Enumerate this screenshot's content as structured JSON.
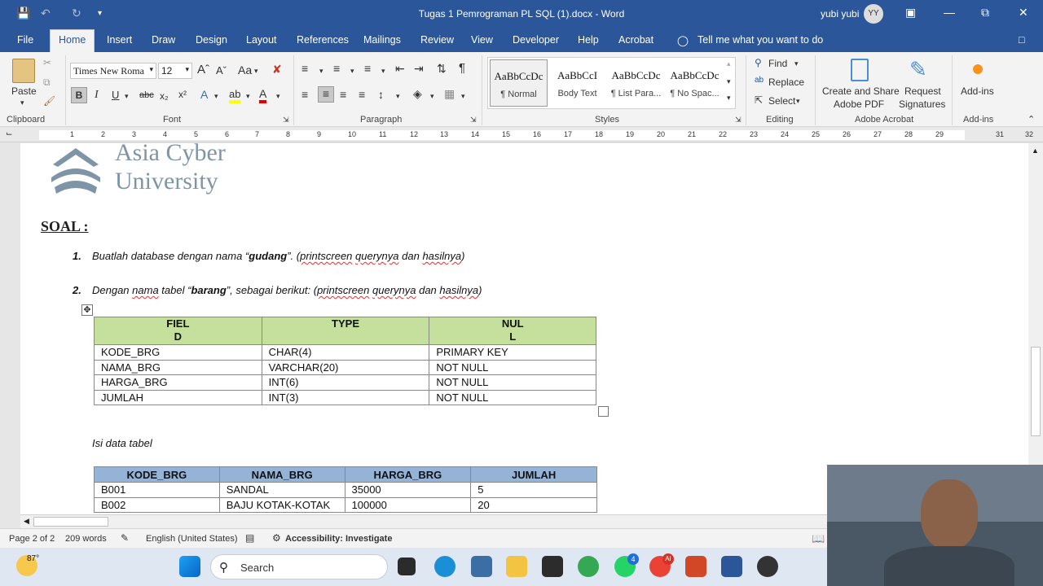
{
  "window": {
    "title": "Tugas 1 Pemrograman PL SQL (1).docx  -  Word",
    "user_name": "yubi yubi",
    "user_initials": "YY"
  },
  "menu": {
    "tabs": [
      "File",
      "Home",
      "Insert",
      "Draw",
      "Design",
      "Layout",
      "References",
      "Mailings",
      "Review",
      "View",
      "Developer",
      "Help",
      "Acrobat"
    ],
    "tell_me": "Tell me what you want to do"
  },
  "ribbon": {
    "clipboard": {
      "paste": "Paste",
      "label": "Clipboard"
    },
    "font": {
      "name": "Times New Roma",
      "size": "12",
      "label": "Font",
      "bold": "B",
      "italic": "I",
      "underline": "U",
      "case": "Aa"
    },
    "paragraph": {
      "label": "Paragraph"
    },
    "styles": {
      "label": "Styles",
      "items": [
        {
          "sample": "AaBbCcDc",
          "name": "¶ Normal"
        },
        {
          "sample": "AaBbCcI",
          "name": "Body Text"
        },
        {
          "sample": "AaBbCcDc",
          "name": "¶ List Para..."
        },
        {
          "sample": "AaBbCcDc",
          "name": "¶ No Spac..."
        }
      ]
    },
    "editing": {
      "find": "Find",
      "replace": "Replace",
      "select": "Select",
      "label": "Editing"
    },
    "acrobat": {
      "create_share_1": "Create and Share",
      "create_share_2": "Adobe PDF",
      "request_1": "Request",
      "request_2": "Signatures",
      "label": "Adobe Acrobat"
    },
    "addins": {
      "button": "Add-ins",
      "label": "Add-ins"
    }
  },
  "ruler": {
    "numbers": [
      "1",
      "2",
      "3",
      "4",
      "5",
      "6",
      "7",
      "8",
      "9",
      "10",
      "11",
      "12",
      "13",
      "14",
      "15",
      "16",
      "17",
      "18",
      "19",
      "20",
      "21",
      "22",
      "23",
      "24",
      "25",
      "26",
      "27",
      "28",
      "29",
      "31",
      "32"
    ]
  },
  "document": {
    "logo_line1": "Asia Cyber",
    "logo_line2": "University",
    "soal": "SOAL :",
    "q1": {
      "num": "1.",
      "a": "Buatlah database dengan nama “",
      "b": "gudang",
      "c": "”. (",
      "d": "printscreen",
      "e": " ",
      "f": "querynya",
      "g": " dan ",
      "h": "hasilnya",
      "i": ")"
    },
    "q2": {
      "num": "2.",
      "a": "Dengan ",
      "b": "nama",
      "c": " tabel “",
      "d": "barang",
      "e": "”, sebagai berikut: (",
      "f": "printscreen",
      "g": " ",
      "h": "querynya",
      "i": " dan ",
      "j": "hasilnya",
      "k": ")"
    },
    "table1": {
      "headers": [
        [
          "FIEL",
          "D"
        ],
        [
          "TYPE",
          ""
        ],
        [
          "NUL",
          "L"
        ]
      ],
      "rows": [
        [
          "KODE_BRG",
          "CHAR(4)",
          "PRIMARY KEY"
        ],
        [
          "NAMA_BRG",
          "VARCHAR(20)",
          "NOT NULL"
        ],
        [
          "HARGA_BRG",
          "INT(6)",
          "NOT NULL"
        ],
        [
          "JUMLAH",
          "INT(3)",
          "NOT NULL"
        ]
      ]
    },
    "isi_label": "Isi data tabel",
    "table2": {
      "headers": [
        "KODE_BRG",
        "NAMA_BRG",
        "HARGA_BRG",
        "JUMLAH"
      ],
      "rows": [
        [
          "B001",
          "SANDAL",
          "35000",
          "5"
        ],
        [
          "B002",
          "BAJU KOTAK-KOTAK",
          "100000",
          "20"
        ]
      ]
    }
  },
  "status": {
    "page": "Page 2 of 2",
    "words": "209 words",
    "language": "English (United States)",
    "accessibility": "Accessibility: Investigate"
  },
  "taskbar": {
    "weather": "87°",
    "search": "Search",
    "whatsapp_badge": "4",
    "ai_badge": "AI"
  },
  "colors": {
    "word_blue": "#2b579a",
    "table1_header": "#c5e09c",
    "table2_header": "#95b3d7"
  }
}
